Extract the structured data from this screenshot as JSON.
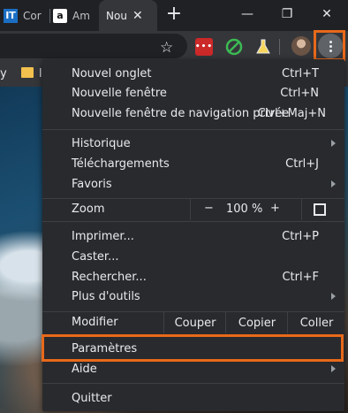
{
  "tabs": [
    {
      "favicon": "IT",
      "title": "Cor"
    },
    {
      "favicon": "a",
      "title": "Am"
    },
    {
      "title": "Nou",
      "active": true
    }
  ],
  "window_controls": {
    "newtab": "+",
    "minimize": "—",
    "restore": "❐",
    "close": "✕"
  },
  "toolbar": {
    "lastpass_label": "•••"
  },
  "bookmarks": {
    "first": "y",
    "second": "l"
  },
  "menu": {
    "group1": [
      {
        "label": "Nouvel onglet",
        "shortcut": "Ctrl+T"
      },
      {
        "label": "Nouvelle fenêtre",
        "shortcut": "Ctrl+N"
      },
      {
        "label": "Nouvelle fenêtre de navigation privée",
        "shortcut": "Ctrl+Maj+N"
      }
    ],
    "group2": [
      {
        "label": "Historique",
        "submenu": true
      },
      {
        "label": "Téléchargements",
        "shortcut": "Ctrl+J"
      },
      {
        "label": "Favoris",
        "submenu": true
      }
    ],
    "zoom": {
      "label": "Zoom",
      "minus": "−",
      "value": "100 %",
      "plus": "+"
    },
    "group3": [
      {
        "label": "Imprimer...",
        "shortcut": "Ctrl+P"
      },
      {
        "label": "Caster..."
      },
      {
        "label": "Rechercher...",
        "shortcut": "Ctrl+F"
      },
      {
        "label": "Plus d'outils",
        "submenu": true
      }
    ],
    "edit": {
      "label": "Modifier",
      "cut": "Couper",
      "copy": "Copier",
      "paste": "Coller"
    },
    "group4": [
      {
        "label": "Paramètres"
      },
      {
        "label": "Aide",
        "submenu": true
      }
    ],
    "quit": {
      "label": "Quitter"
    }
  },
  "colors": {
    "highlight": "#e8691a",
    "menu_bg": "#292a2d",
    "text": "#e8eaed"
  }
}
